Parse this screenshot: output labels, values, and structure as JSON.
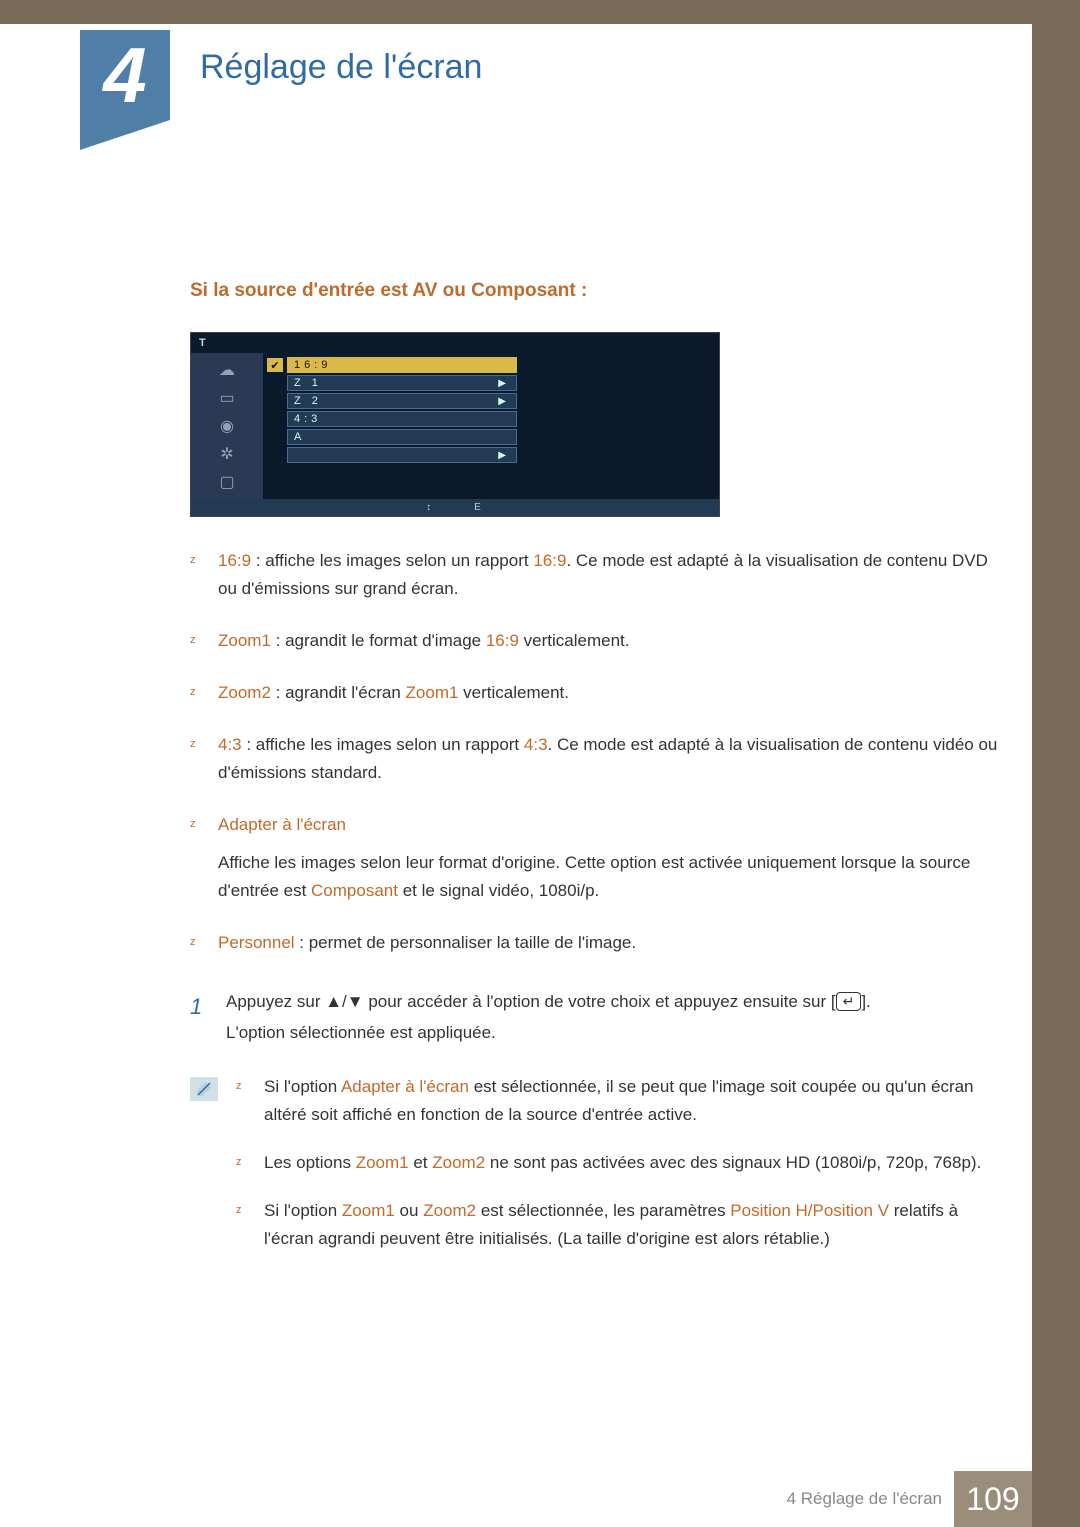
{
  "chapter": {
    "number": "4",
    "title": "Réglage de l'écran"
  },
  "section_title": "Si la source d'entrée est AV ou Composant :",
  "osd": {
    "title": "T",
    "rows": {
      "r0": "16:9",
      "r1": "Z           1",
      "r2": "Z           2",
      "r3": "4:3",
      "r4": "A",
      "r5": ""
    },
    "footer_a": "↕",
    "footer_b": "E"
  },
  "modes": {
    "m0": {
      "label": "16:9",
      "text_a": " : affiche les images selon un rapport ",
      "ratio": "16:9",
      "text_b": ". Ce mode est adapté à la visualisation de contenu DVD ou d'émissions sur grand écran."
    },
    "m1": {
      "label": "Zoom1",
      "text_a": " : agrandit le format d'image ",
      "ratio": "16:9",
      "text_b": " verticalement."
    },
    "m2": {
      "label": "Zoom2",
      "text_a": " : agrandit l'écran ",
      "ref": "Zoom1",
      "text_b": " verticalement."
    },
    "m3": {
      "label": "4:3",
      "text_a": " : affiche les images selon un rapport ",
      "ratio": "4:3",
      "text_b": ". Ce mode est adapté à la visualisation de contenu vidéo ou d'émissions standard."
    },
    "m4": {
      "label": "Adapter à l'écran",
      "desc_a": "Affiche les images selon leur format d'origine. Cette option est activée uniquement lorsque la source d'entrée est ",
      "comp": "Composant",
      "desc_b": " et le signal vidéo, 1080i/p."
    },
    "m5": {
      "label": "Personnel",
      "text_a": " : permet de personnaliser la taille de l'image."
    }
  },
  "step": {
    "num": "1",
    "text_a": "Appuyez sur ▲/▼ pour accéder à l'option de votre choix et appuyez ensuite sur [",
    "text_b": "].",
    "text_c": "L'option sélectionnée est appliquée.",
    "enter_glyph": "↵"
  },
  "notes": {
    "n0": {
      "a": "Si l'option ",
      "hl": "Adapter à l'écran",
      "b": " est sélectionnée, il se peut que l'image soit coupée ou qu'un écran altéré soit affiché en fonction de la source d'entrée active."
    },
    "n1": {
      "a": "Les options ",
      "hl1": "Zoom1",
      "mid": " et ",
      "hl2": "Zoom2",
      "b": " ne sont pas activées avec des signaux HD (1080i/p, 720p, 768p)."
    },
    "n2": {
      "a": "Si l'option ",
      "hl1": "Zoom1",
      "mid": " ou ",
      "hl2": "Zoom2",
      "b": " est sélectionnée, les paramètres ",
      "hl3": "Position H/Position V",
      "c": " relatifs à l'écran agrandi peuvent être initialisés. (La taille d'origine est alors rétablie.)"
    }
  },
  "footer": {
    "text": "4 Réglage de l'écran",
    "page": "109"
  }
}
